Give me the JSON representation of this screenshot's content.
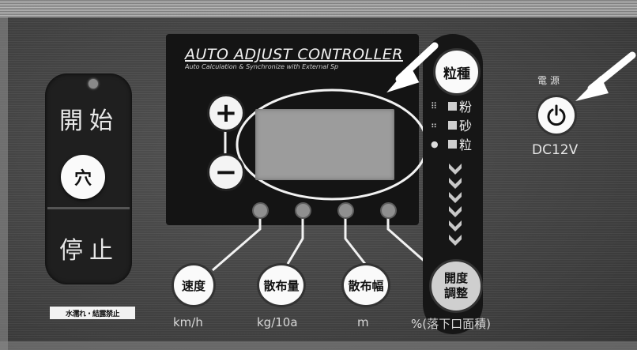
{
  "start_stop": {
    "start_label": "開始",
    "hole_label": "穴",
    "stop_label": "停止",
    "warning": "水濡れ・結露禁止"
  },
  "controller": {
    "title": "AUTO ADJUST CONTROLLER",
    "subtitle": "Auto Calculation & Synchronize with External Sp",
    "plus_label": "+",
    "minus_label": "−"
  },
  "grain": {
    "button_label": "粒種",
    "options": [
      {
        "symbol": "⠿",
        "label": "粉"
      },
      {
        "symbol": "⠶",
        "label": "砂"
      },
      {
        "symbol": "●",
        "label": "粒"
      }
    ],
    "adjust_line1": "開度",
    "adjust_line2": "調整"
  },
  "functions": [
    {
      "label": "速度",
      "unit": "km/h"
    },
    {
      "label": "散布量",
      "unit": "kg/10a"
    },
    {
      "label": "散布幅",
      "unit": "m"
    }
  ],
  "open_unit": "%(落下口面積)",
  "power": {
    "label": "電源",
    "voltage": "DC12V"
  },
  "colors": {
    "panel": "#444444",
    "button": "#fafafa",
    "display": "#9c9c9c",
    "arrow": "#ffffff"
  }
}
